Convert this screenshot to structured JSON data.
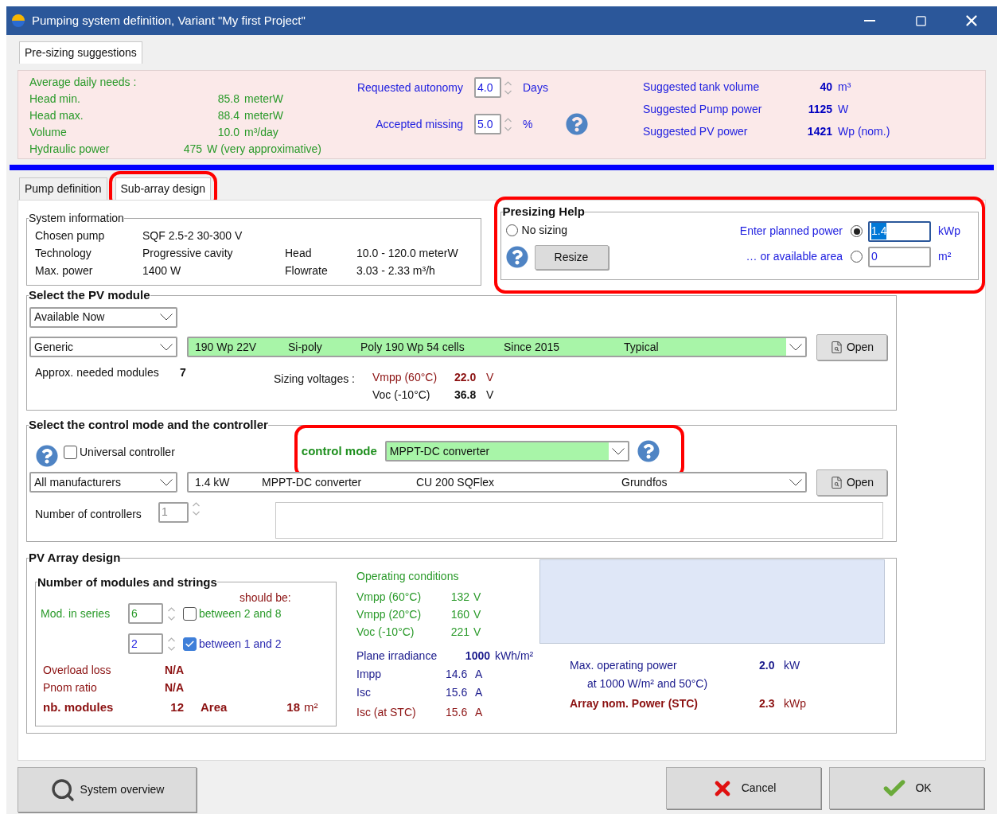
{
  "window": {
    "title": "Pumping system definition, Variant  \"My first Project\""
  },
  "top_tab": {
    "label": "Pre-sizing suggestions",
    "selected": true
  },
  "needs": {
    "title": "Average daily needs :",
    "rows": [
      {
        "label": "Head min.",
        "value": "85.8",
        "unit": "meterW"
      },
      {
        "label": "Head max.",
        "value": "88.4",
        "unit": "meterW"
      },
      {
        "label": "Volume",
        "value": "10.0",
        "unit": "m³/day"
      },
      {
        "label": "Hydraulic power",
        "value": "475",
        "unit": "W  (very approximative)"
      }
    ]
  },
  "autonomy": {
    "label": "Requested autonomy",
    "value": "4.0",
    "unit": "Days"
  },
  "missing": {
    "label": "Accepted missing",
    "value": "5.0",
    "unit": "%"
  },
  "suggestions": [
    {
      "label": "Suggested tank volume",
      "value": "40",
      "unit": "m³"
    },
    {
      "label": "Suggested Pump power",
      "value": "1125",
      "unit": "W"
    },
    {
      "label": "Suggested PV power",
      "value": "1421",
      "unit": "Wp (nom.)"
    }
  ],
  "tabs": [
    {
      "label": "Pump definition",
      "selected": false
    },
    {
      "label": "Sub-array design",
      "selected": true
    }
  ],
  "system_info": {
    "title": "System information",
    "rows": [
      {
        "label": "Chosen pump",
        "value": "SQF 2.5-2  30-300 V"
      },
      {
        "label": "Technology",
        "value": "Progressive cavity",
        "label2": "Head",
        "value2": "10.0 - 120.0 meterW"
      },
      {
        "label": "Max. power",
        "value": "1400 W",
        "label2": "Flowrate",
        "value2": "3.03 - 2.33 m³/h"
      }
    ]
  },
  "presizing": {
    "title": "Presizing Help",
    "no_sizing": {
      "label": "No sizing",
      "selected": false
    },
    "resize_button": "Resize",
    "options": [
      {
        "label": "Enter planned power",
        "selected": true,
        "value": "1.4",
        "unit": "kWp"
      },
      {
        "label": "…  or available area",
        "selected": false,
        "value": "0",
        "unit": "m²"
      }
    ]
  },
  "pv_module": {
    "title": "Select the PV module",
    "availability": "Available Now",
    "manufacturer": "Generic",
    "module": [
      "190 Wp 22V",
      "Si-poly",
      "Poly 190 Wp  54 cells",
      "Since 2015",
      "Typical"
    ],
    "open_button": "Open",
    "needed_label": "Approx. needed modules",
    "needed_value": "7",
    "sizing_label": "Sizing voltages :",
    "voltages": [
      {
        "label": "Vmpp (60°C)",
        "value": "22.0",
        "unit": "V",
        "kind": "alert"
      },
      {
        "label": "Voc (-10°C)",
        "value": "36.8",
        "unit": "V",
        "kind": "normal"
      }
    ]
  },
  "controller": {
    "title": "Select the control mode and the controller",
    "universal": {
      "label": "Universal controller",
      "checked": false
    },
    "mode_label": "control mode",
    "mode": "MPPT-DC converter",
    "manufacturer": "All manufacturers",
    "device": [
      "1.4 kW",
      "MPPT-DC converter",
      "CU 200 SQFlex",
      "Grundfos"
    ],
    "open_button": "Open",
    "count_label": "Number of controllers",
    "count": "1"
  },
  "array": {
    "title": "PV Array design",
    "strings_title": "Number of modules and strings",
    "should_be": "should be:",
    "series": {
      "label": "Mod. in series",
      "value": "6",
      "hint": "between 2 and 8",
      "checked": false
    },
    "parallel": {
      "value": "2",
      "hint": "between 1 and 2",
      "checked": true
    },
    "results": [
      {
        "label": "Overload loss",
        "value": "N/A"
      },
      {
        "label": "Pnom ratio",
        "value": "N/A"
      }
    ],
    "nb_modules": {
      "label": "nb. modules",
      "value": "12"
    },
    "area": {
      "label": "Area",
      "value": "18",
      "unit": "m²"
    },
    "operating": {
      "title": "Operating conditions",
      "rows": [
        {
          "label": "Vmpp (60°C)",
          "value": "132",
          "unit": "V"
        },
        {
          "label": "Vmpp (20°C)",
          "value": "160",
          "unit": "V"
        },
        {
          "label": "Voc (-10°C)",
          "value": "221",
          "unit": "V"
        }
      ]
    },
    "irradiance": {
      "label": "Plane irradiance",
      "value": "1000",
      "unit": "kWh/m²"
    },
    "currents": [
      {
        "label": "Impp",
        "value": "14.6",
        "unit": "A",
        "kind": "normal"
      },
      {
        "label": "Isc",
        "value": "15.6",
        "unit": "A",
        "kind": "normal"
      },
      {
        "label": "Isc (at STC)",
        "value": "15.6",
        "unit": "A",
        "kind": "stc"
      }
    ],
    "max_power": {
      "label": "Max. operating power",
      "sub": "at 1000 W/m²  and 50°C)",
      "value": "2.0",
      "unit": "kW"
    },
    "nom_power": {
      "label": "Array nom. Power (STC)",
      "value": "2.3",
      "unit": "kWp"
    }
  },
  "buttons": {
    "overview": "System overview",
    "cancel": "Cancel",
    "ok": "OK"
  }
}
